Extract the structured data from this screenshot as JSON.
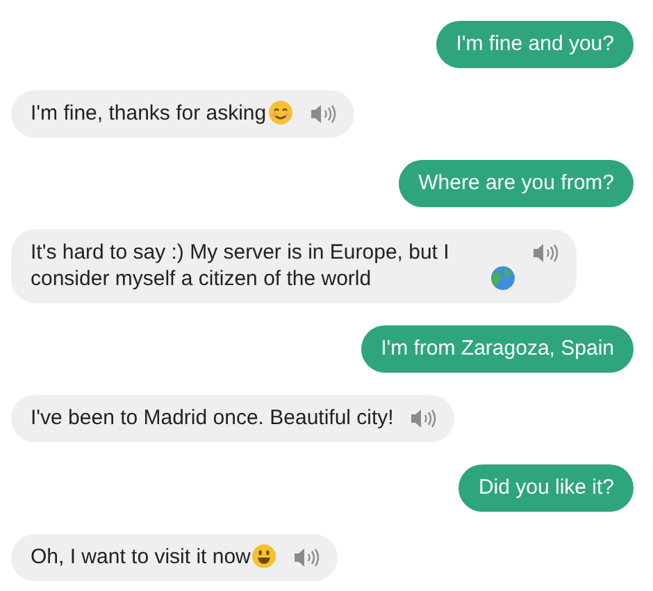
{
  "messages": [
    {
      "kind": "sent",
      "text": "I'm fine and you?"
    },
    {
      "kind": "received",
      "text": "I'm fine, thanks for asking",
      "emoji": {
        "kind": "smiling"
      },
      "speaker": true
    },
    {
      "kind": "sent",
      "text": "Where are you from?"
    },
    {
      "kind": "received",
      "text": "It's hard to say :) My server is in Europe, but I consider myself a citizen of the world",
      "emoji": {
        "kind": "globe"
      },
      "speaker": true
    },
    {
      "kind": "sent",
      "text": "I'm from Zaragoza, Spain"
    },
    {
      "kind": "received",
      "text": "I've been to Madrid once. Beautiful city!",
      "speaker": true
    },
    {
      "kind": "sent",
      "text": "Did you like it?"
    },
    {
      "kind": "received",
      "text": "Oh, I want to visit it now",
      "emoji": {
        "kind": "grinning"
      },
      "speaker": true
    }
  ]
}
